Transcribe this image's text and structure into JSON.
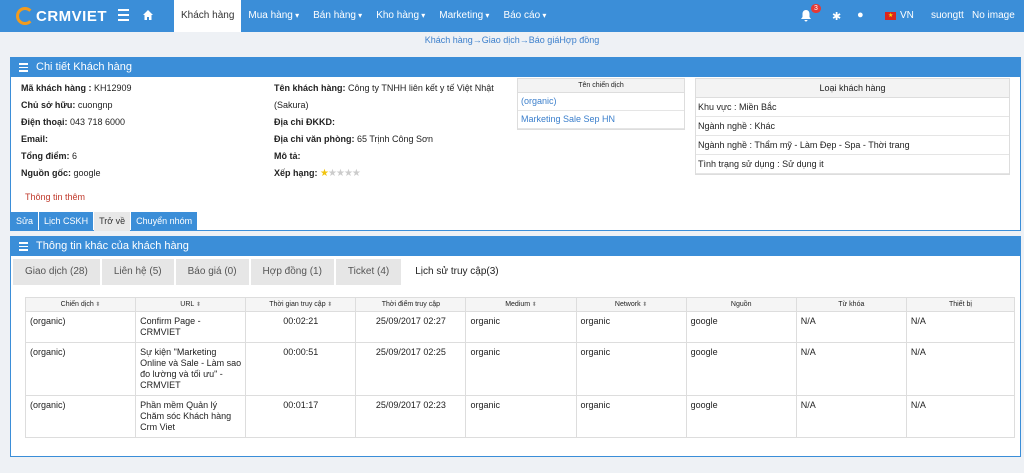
{
  "header": {
    "logo_text": "CRMVIET",
    "menu": [
      {
        "label": "Khách hàng",
        "active": true
      },
      {
        "label": "Mua hàng"
      },
      {
        "label": "Bán hàng"
      },
      {
        "label": "Kho hàng"
      },
      {
        "label": "Marketing"
      },
      {
        "label": "Báo cáo"
      }
    ],
    "notification_count": "3",
    "language": "VN",
    "username": "suongtt",
    "avatar_text": "No image"
  },
  "breadcrumb": "Khách hàng→Giao dịch→Báo giáHợp đồng",
  "detail": {
    "title": "Chi tiết Khách hàng",
    "left": [
      {
        "label": "Mã khách hàng :",
        "value": " KH12909"
      },
      {
        "label": "Chủ sở hữu:",
        "value": " cuongnp"
      },
      {
        "label": "Điện thoại:",
        "value": " 043 718 6000"
      },
      {
        "label": "Email:",
        "value": ""
      },
      {
        "label": "Tổng điểm:",
        "value": " 6"
      },
      {
        "label": "Nguồn gốc:",
        "value": " google"
      }
    ],
    "mid": [
      {
        "label": "Tên khách hàng:",
        "value": " Công ty TNHH liên kết y tế Việt Nhật (Sakura)"
      },
      {
        "label": "Địa chỉ ĐKKD:",
        "value": ""
      },
      {
        "label": "Địa chỉ văn phòng:",
        "value": " 65 Trịnh Công Sơn"
      },
      {
        "label": "Mô tả:",
        "value": ""
      },
      {
        "label": "Xếp hạng:",
        "value": ""
      }
    ],
    "rating": 1,
    "rating_max": 5,
    "campaign_header": "Tên chiến dịch",
    "campaigns": [
      "(organic)",
      "Marketing Sale Sep HN"
    ],
    "customer_type_header": "Loại khách hàng",
    "customer_type_rows": [
      "Khu vực : Miền Bắc",
      "Ngành nghề : Khác",
      "Ngành nghề : Thẩm mỹ - Làm Đẹp - Spa - Thời trang",
      "Tình trạng sử dụng : Sử dụng it"
    ],
    "more_info": "Thông tin thêm",
    "buttons": [
      {
        "label": "Sửa",
        "style": "primary"
      },
      {
        "label": "Lịch CSKH",
        "style": "primary"
      },
      {
        "label": "Trở về",
        "style": "plain"
      },
      {
        "label": "Chuyển nhóm",
        "style": "primary"
      }
    ]
  },
  "other": {
    "title": "Thông tin khác của khách hàng",
    "tabs": [
      {
        "label": "Giao dịch (28)"
      },
      {
        "label": "Liên hệ (5)"
      },
      {
        "label": "Báo giá (0)"
      },
      {
        "label": "Hợp đồng (1)"
      },
      {
        "label": "Ticket (4)"
      },
      {
        "label": "Lịch sử truy cập(3)",
        "active": true
      }
    ],
    "columns": [
      {
        "label": "Chiến dịch",
        "sortable": true
      },
      {
        "label": "URL",
        "sortable": true
      },
      {
        "label": "Thời gian truy cập",
        "sortable": true
      },
      {
        "label": "Thời điểm truy cập",
        "sortable": false
      },
      {
        "label": "Medium",
        "sortable": true
      },
      {
        "label": "Network",
        "sortable": true
      },
      {
        "label": "Nguồn",
        "sortable": false
      },
      {
        "label": "Từ khóa",
        "sortable": false
      },
      {
        "label": "Thiết bị",
        "sortable": false
      }
    ],
    "rows": [
      [
        "(organic)",
        "Confirm Page - CRMVIET",
        "00:02:21",
        "25/09/2017 02:27",
        "organic",
        "organic",
        "google",
        "N/A",
        "N/A"
      ],
      [
        "(organic)",
        "Sự kiện \"Marketing Online và Sale - Làm sao đo lường và tối ưu\" - CRMVIET",
        "00:00:51",
        "25/09/2017 02:25",
        "organic",
        "organic",
        "google",
        "N/A",
        "N/A"
      ],
      [
        "(organic)",
        "Phần mềm Quản lý Chăm sóc Khách hàng Crm Viet",
        "00:01:17",
        "25/09/2017 02:23",
        "organic",
        "organic",
        "google",
        "N/A",
        "N/A"
      ]
    ]
  },
  "colors": {
    "primary": "#3b8ed8",
    "accent": "#f29b1d",
    "link": "#3b7fcc"
  }
}
